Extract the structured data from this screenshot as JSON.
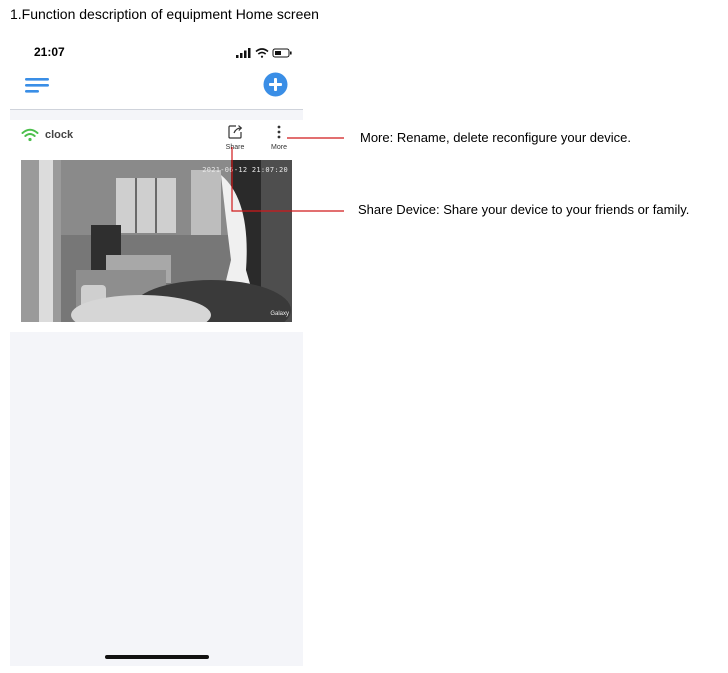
{
  "heading": "1.Function description of equipment Home screen",
  "status_bar": {
    "time": "21:07"
  },
  "device_card": {
    "name": "clock",
    "share_label": "Share",
    "more_label": "More",
    "feed_timestamp": "2021-06-12  21:07:20",
    "feed_watermark": "Galaxy"
  },
  "annotations": {
    "more": "More: Rename, delete reconfigure your device.",
    "share": "Share Device: Share your device to your friends or family."
  },
  "colors": {
    "accent": "#3a8ee6",
    "wifi": "#4cbf4c",
    "callout_line": "#d0191b"
  }
}
